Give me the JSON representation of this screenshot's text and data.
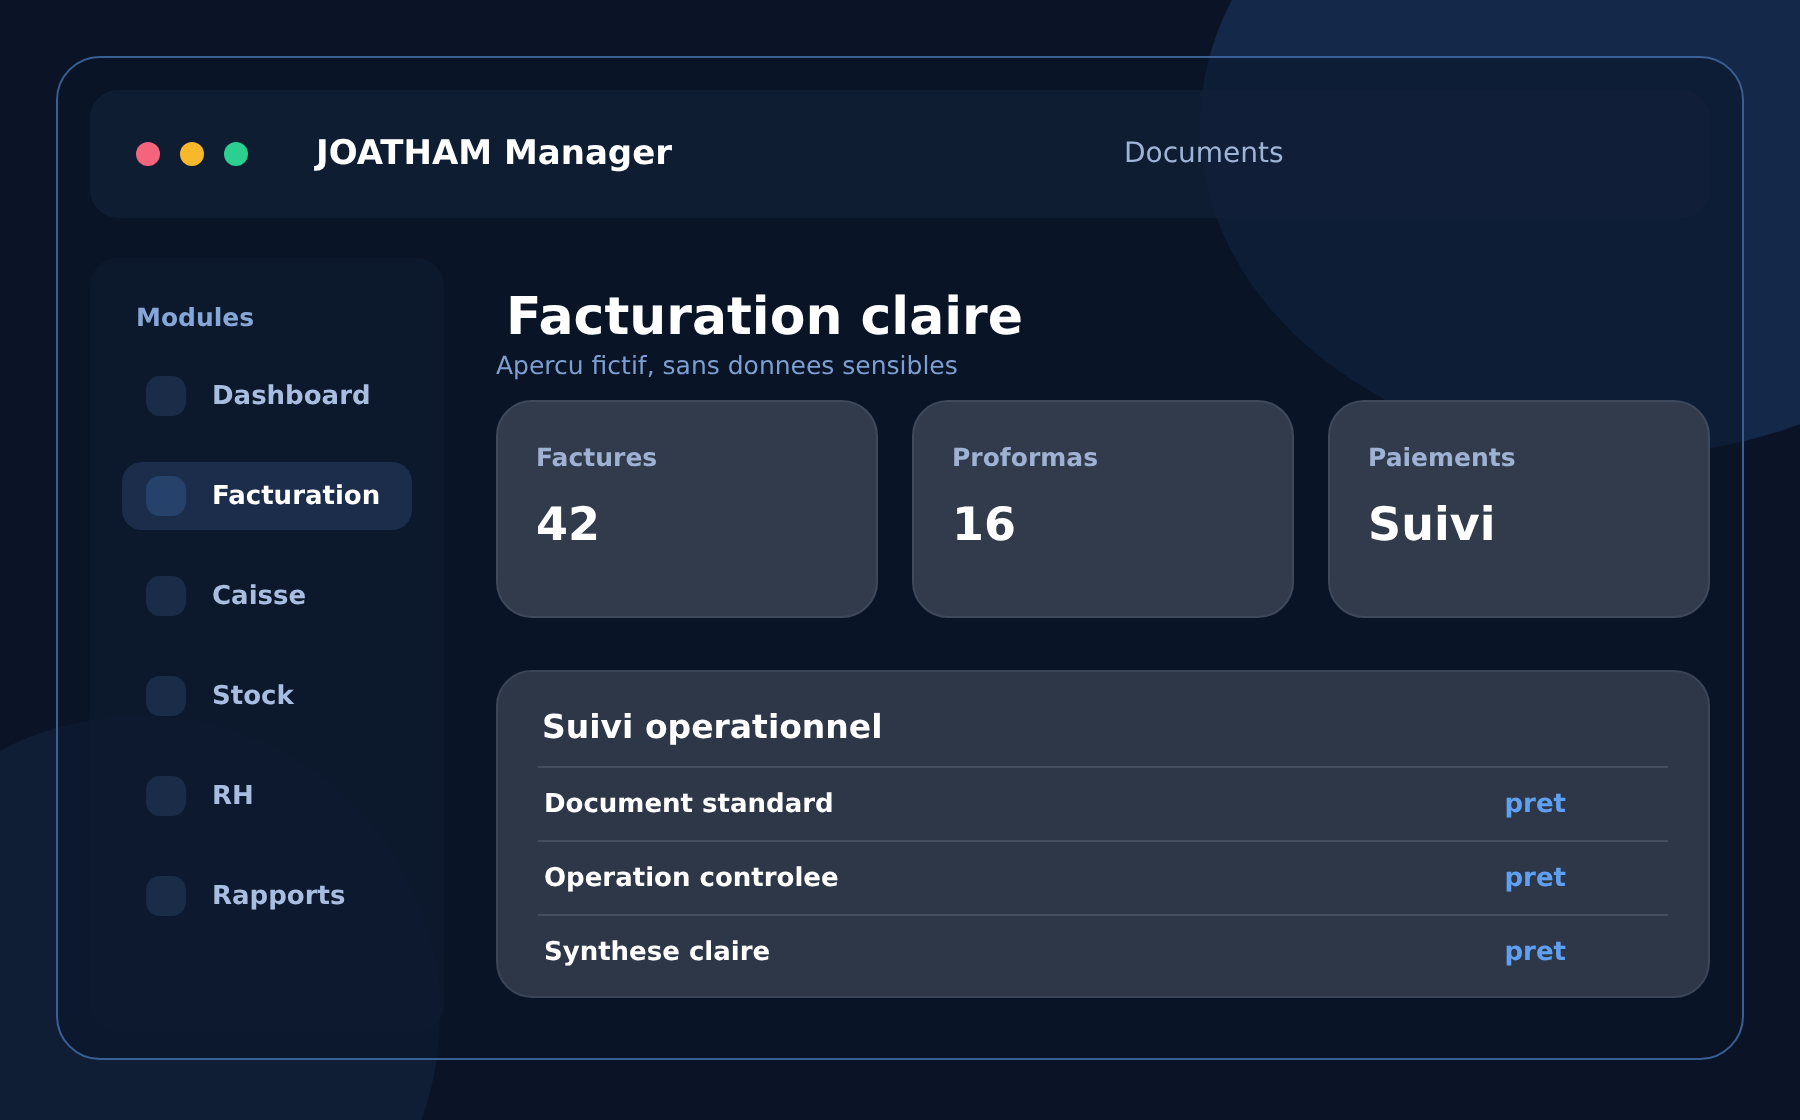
{
  "window": {
    "title": "JOATHAM Manager",
    "nav_link": "Documents"
  },
  "sidebar": {
    "heading": "Modules",
    "items": [
      {
        "label": "Dashboard",
        "selected": false
      },
      {
        "label": "Facturation",
        "selected": true
      },
      {
        "label": "Caisse",
        "selected": false
      },
      {
        "label": "Stock",
        "selected": false
      },
      {
        "label": "RH",
        "selected": false
      },
      {
        "label": "Rapports",
        "selected": false
      }
    ]
  },
  "main": {
    "title": "Facturation claire",
    "subtitle": "Apercu fictif, sans donnees sensibles",
    "cards": [
      {
        "label": "Factures",
        "value": "42"
      },
      {
        "label": "Proformas",
        "value": "16"
      },
      {
        "label": "Paiements",
        "value": "Suivi"
      }
    ],
    "panel": {
      "title": "Suivi operationnel",
      "rows": [
        {
          "name": "Document standard",
          "status": "pret"
        },
        {
          "name": "Operation controlee",
          "status": "pret"
        },
        {
          "name": "Synthese claire",
          "status": "pret"
        }
      ]
    }
  }
}
